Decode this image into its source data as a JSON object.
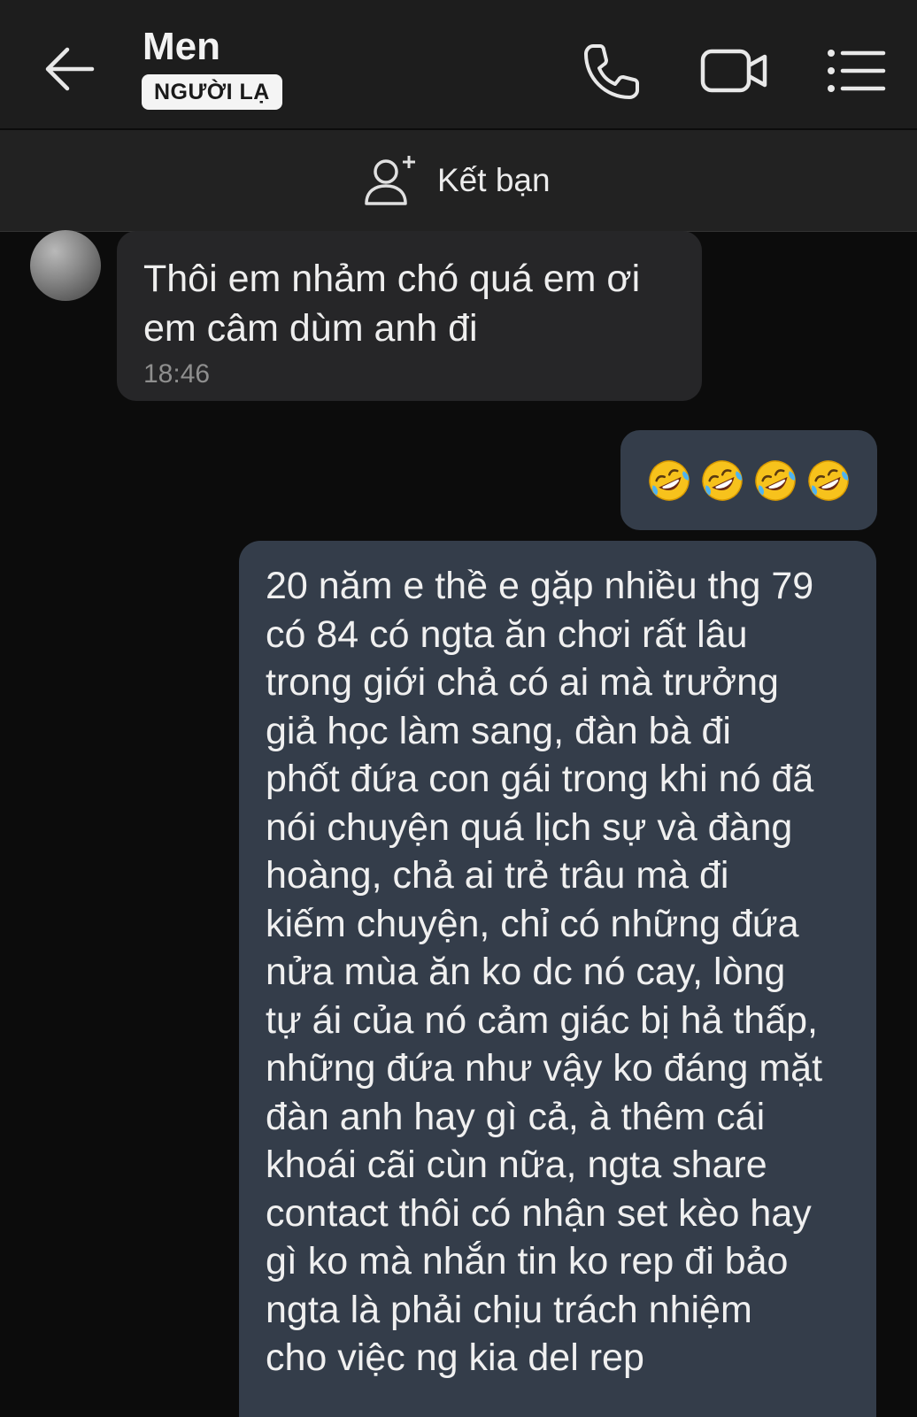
{
  "header": {
    "contact_name": "Men",
    "badge": "NGƯỜI LẠ",
    "icons": {
      "back": "arrow-left-icon",
      "call": "phone-icon",
      "video": "video-camera-icon",
      "menu": "list-menu-icon"
    }
  },
  "friend_bar": {
    "label": "Kết bạn",
    "icon": "add-person-icon"
  },
  "messages": [
    {
      "direction": "incoming",
      "lines": [
        "Thôi em nhảm chó quá em ơi",
        "em câm dùm anh đi"
      ],
      "time": "18:46"
    },
    {
      "direction": "outgoing",
      "emoji": [
        "rolling-on-floor-laughing-icon",
        "rolling-on-floor-laughing-icon",
        "rolling-on-floor-laughing-icon",
        "rolling-on-floor-laughing-icon"
      ]
    },
    {
      "direction": "outgoing",
      "lines": [
        "20 năm e thề e gặp nhiều thg 79",
        "có 84 có ngta ăn chơi rất lâu",
        "trong giới chả có ai mà trưởng",
        "giả học làm sang, đàn bà đi",
        "phốt đứa con gái trong khi nó đã",
        "nói chuyện quá lịch sự và đàng",
        "hoàng, chả ai trẻ trâu mà đi",
        "kiếm chuyện, chỉ có những đứa",
        "nửa mùa ăn ko dc nó cay, lòng",
        "tự ái của nó cảm giác bị hả thấp,",
        "những đứa như vậy ko đáng mặt",
        "đàn anh hay gì cả, à thêm cái",
        "khoái cãi cùn nữa, ngta share",
        "contact thôi có nhận set kèo hay",
        "gì ko mà nhắn tin ko rep đi bảo",
        "ngta là phải chịu trách nhiệm",
        "cho việc ng kia del rep"
      ]
    }
  ],
  "colors": {
    "background": "#0c0c0c",
    "header": "#1d1d1d",
    "incoming_bubble": "#262628",
    "outgoing_bubble": "#343d4a"
  }
}
